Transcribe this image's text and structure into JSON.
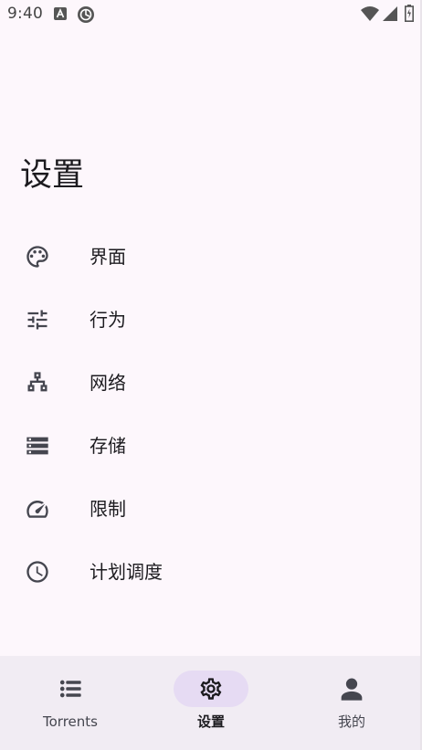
{
  "status_bar": {
    "time": "9:40",
    "icons": [
      "a-icon",
      "sync-icon",
      "wifi-icon",
      "signal-icon",
      "battery-icon"
    ]
  },
  "page": {
    "title": "设置"
  },
  "settings": {
    "items": [
      {
        "label": "界面",
        "icon": "palette-icon"
      },
      {
        "label": "行为",
        "icon": "tune-icon"
      },
      {
        "label": "网络",
        "icon": "network-icon"
      },
      {
        "label": "存储",
        "icon": "storage-icon"
      },
      {
        "label": "限制",
        "icon": "speed-icon"
      },
      {
        "label": "计划调度",
        "icon": "clock-icon"
      }
    ]
  },
  "bottom_nav": {
    "items": [
      {
        "label": "Torrents",
        "icon": "list-icon",
        "active": false
      },
      {
        "label": "设置",
        "icon": "gear-icon",
        "active": true
      },
      {
        "label": "我的",
        "icon": "person-icon",
        "active": false
      }
    ]
  },
  "colors": {
    "background": "#fdf7fc",
    "nav_background": "#f1ecf3",
    "active_pill": "#e6dbf3",
    "text_primary": "#1c1b1f",
    "icon": "#45464f"
  }
}
